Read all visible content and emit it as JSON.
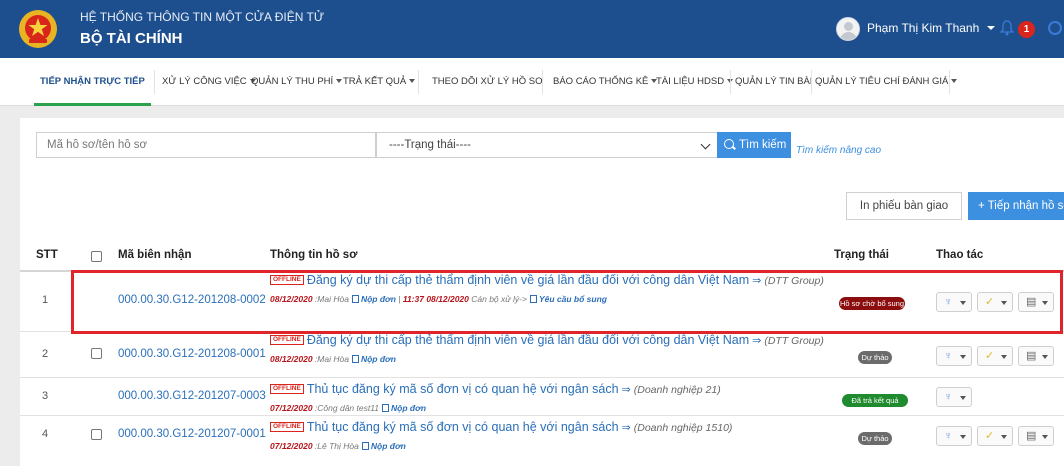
{
  "header": {
    "subtitle": "HỆ THỐNG THÔNG TIN MỘT CỬA ĐIỆN TỬ",
    "title": "BỘ TÀI CHÍNH",
    "user_name": "Phạm Thị Kim Thanh",
    "notification_count": "1",
    "brand_color": "#1d4f8e"
  },
  "nav": {
    "items": [
      {
        "label": "TIẾP NHẬN TRỰC TIẾP",
        "active": true
      },
      {
        "label": "XỬ LÝ CÔNG VIỆC",
        "dropdown": true
      },
      {
        "label": "QUẢN LÝ THU PHÍ",
        "dropdown": true
      },
      {
        "label": "TRẢ KẾT QUẢ",
        "dropdown": true
      },
      {
        "label": "THEO DÕI XỬ LÝ HỒ SƠ"
      },
      {
        "label": "BÁO CÁO THỐNG KÊ",
        "dropdown": true
      },
      {
        "label": "TÀI LIỆU HDSD",
        "dropdown": true
      },
      {
        "label": "QUẢN LÝ TIN BÀI"
      },
      {
        "label": "QUẢN LÝ TIÊU CHÍ ĐÁNH GIÁ",
        "dropdown": true
      }
    ]
  },
  "search": {
    "placeholder": "Mã hồ sơ/tên hồ sơ",
    "status_value": "----Trạng thái----",
    "button_label": "Tìm kiếm",
    "advanced_label": "Tìm kiếm nâng cao"
  },
  "actions": {
    "print_label": "In phiếu bàn giao",
    "add_label": "+ Tiếp nhận hồ sơ"
  },
  "table": {
    "headers": {
      "stt": "STT",
      "code": "Mã biên nhận",
      "info": "Thông tin hồ sơ",
      "status": "Trạng thái",
      "actions": "Thao tác"
    },
    "rows": [
      {
        "stt": "1",
        "code": "000.00.30.G12-201208-0002",
        "badge": "OFFLINE",
        "title": "Đăng ký dự thi cấp thẻ thẩm định viên về giá lần đầu đối với công dân Việt Nam",
        "org": "(DTT Group)",
        "date": "08/12/2020",
        "person": ":Mai Hòa",
        "action": "Nộp đơn",
        "extra_prefix": " | ",
        "extra_time": "11:37 08/12/2020",
        "extra_text": " Cán bộ xử lý->",
        "extra_action": "Yêu cầu bổ sung",
        "status": "Hồ sơ chờ bổ sung",
        "status_color": "#8b0d0d",
        "has_checkbox": false
      },
      {
        "stt": "2",
        "code": "000.00.30.G12-201208-0001",
        "badge": "OFFLINE",
        "title": "Đăng ký dự thi cấp thẻ thẩm định viên về giá lần đầu đối với công dân Việt Nam",
        "org": "(DTT Group)",
        "date": "08/12/2020",
        "person": ":Mai Hòa",
        "action": "Nộp đơn",
        "status": "Dự thảo",
        "status_color": "#6b6b6b",
        "has_checkbox": true
      },
      {
        "stt": "3",
        "code": "000.00.30.G12-201207-0003",
        "badge": "OFFLINE",
        "title": "Thủ tục đăng ký mã số đơn vị có quan hệ với ngân sách",
        "org": "(Doanh nghiệp 21)",
        "date": "07/12/2020",
        "person": ":Công dân test11",
        "action": "Nộp đơn",
        "status": "Đã trả kết quả",
        "status_color": "#1f8a2e",
        "has_checkbox": false
      },
      {
        "stt": "4",
        "code": "000.00.30.G12-201207-0001",
        "badge": "OFFLINE",
        "title": "Thủ tục đăng ký mã số đơn vị có quan hệ với ngân sách",
        "org": "(Doanh nghiệp 1510)",
        "date": "07/12/2020",
        "person": ":Lê Thị Hòa",
        "action": "Nộp đơn",
        "status": "Dự thảo",
        "status_color": "#6b6b6b",
        "has_checkbox": true
      }
    ]
  },
  "icons": [
    "emblem-icon",
    "avatar-icon",
    "bell-icon",
    "search-icon",
    "arrow-icon",
    "document-icon",
    "process-icon",
    "approve-icon",
    "print-icon"
  ],
  "colors": {
    "accent": "#3d8fe0",
    "link": "#2a6fb8",
    "active_tab_underline": "#2aa14a",
    "highlight": "#e0252a"
  }
}
